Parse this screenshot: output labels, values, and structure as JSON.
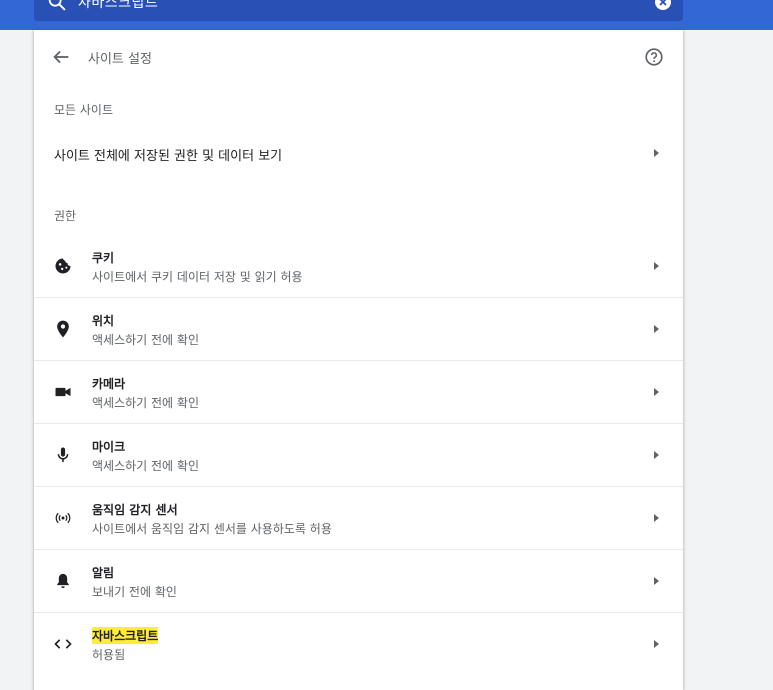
{
  "search": {
    "value": "자바스크립트"
  },
  "header": {
    "title": "사이트 설정"
  },
  "all_sites": {
    "section_label": "모든 사이트",
    "row_label": "사이트 전체에 저장된 권한 및 데이터 보기"
  },
  "permissions": {
    "section_label": "권한",
    "items": [
      {
        "title": "쿠키",
        "subtitle": "사이트에서 쿠키 데이터 저장 및 읽기 허용",
        "icon": "cookie-icon"
      },
      {
        "title": "위치",
        "subtitle": "액세스하기 전에 확인",
        "icon": "location-icon"
      },
      {
        "title": "카메라",
        "subtitle": "액세스하기 전에 확인",
        "icon": "camera-icon"
      },
      {
        "title": "마이크",
        "subtitle": "액세스하기 전에 확인",
        "icon": "microphone-icon"
      },
      {
        "title": "움직임 감지 센서",
        "subtitle": "사이트에서 움직임 감지 센서를 사용하도록 허용",
        "icon": "motion-sensor-icon"
      },
      {
        "title": "알림",
        "subtitle": "보내기 전에 확인",
        "icon": "bell-icon"
      },
      {
        "title": "자바스크립트",
        "subtitle": "허용됨",
        "icon": "code-icon"
      }
    ]
  },
  "colors": {
    "topbar": "#3367d6",
    "search_bg": "#2951b5",
    "highlight": "#ffeb3b",
    "icon": "#202124"
  }
}
